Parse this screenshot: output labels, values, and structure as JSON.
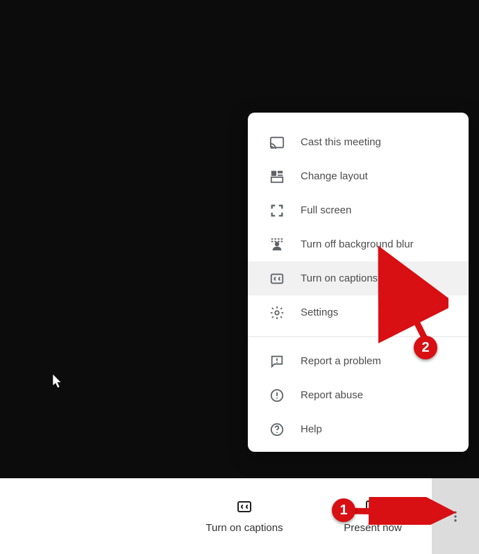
{
  "menu": {
    "items": [
      {
        "id": "cast",
        "label": "Cast this meeting"
      },
      {
        "id": "layout",
        "label": "Change layout"
      },
      {
        "id": "fullscreen",
        "label": "Full screen"
      },
      {
        "id": "bgblur",
        "label": "Turn off background blur"
      },
      {
        "id": "captions",
        "label": "Turn on captions"
      },
      {
        "id": "settings",
        "label": "Settings"
      },
      {
        "id": "report",
        "label": "Report a problem"
      },
      {
        "id": "abuse",
        "label": "Report abuse"
      },
      {
        "id": "help",
        "label": "Help"
      }
    ]
  },
  "toolbar": {
    "captions_label": "Turn on captions",
    "present_label": "Present now"
  },
  "annotations": {
    "badge1": "1",
    "badge2": "2"
  },
  "colors": {
    "annotation": "#d80f13",
    "menu_hover": "#f1f1f1",
    "video_bg": "#0c0c0c"
  }
}
